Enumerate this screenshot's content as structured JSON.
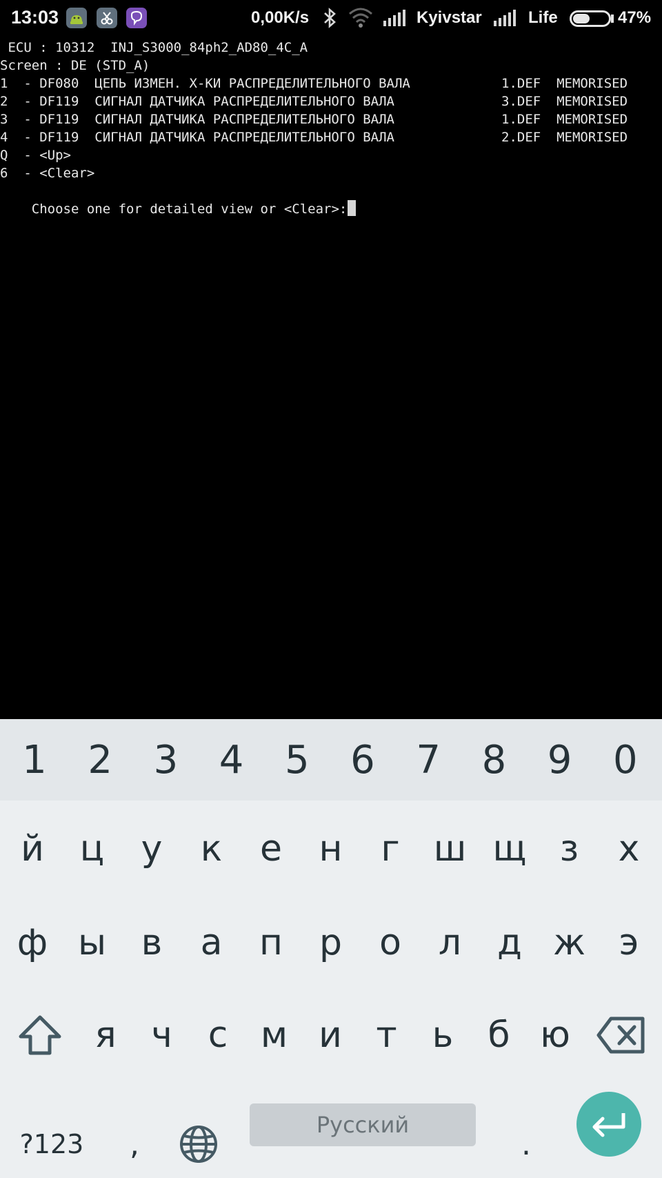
{
  "status_bar": {
    "time": "13:03",
    "net_speed": "0,00K/s",
    "operator_1": "Kyivstar",
    "operator_2": "Life",
    "battery_percent": "47%",
    "battery_level": 0.47,
    "app_icons": [
      "android-app-icon",
      "scissors-app-icon",
      "viber-icon"
    ]
  },
  "terminal": {
    "ecu_line": " ECU : 10312  INJ_S3000_84ph2_AD80_4C_A",
    "screen_line": "Screen : DE (STD_A)",
    "faults": [
      {
        "text": "1  - DF080  ЦЕПЬ ИЗМЕН. Х-КИ РАСПРЕДЕЛИТЕЛЬНОГО ВАЛА",
        "status": "1.DEF  MEMORISED"
      },
      {
        "text": "2  - DF119  СИГНАЛ ДАТЧИКА РАСПРЕДЕЛИТЕЛЬНОГО ВАЛА",
        "status": "3.DEF  MEMORISED"
      },
      {
        "text": "3  - DF119  СИГНАЛ ДАТЧИКА РАСПРЕДЕЛИТЕЛЬНОГО ВАЛА",
        "status": "1.DEF  MEMORISED"
      },
      {
        "text": "4  - DF119  СИГНАЛ ДАТЧИКА РАСПРЕДЕЛИТЕЛЬНОГО ВАЛА",
        "status": "2.DEF  MEMORISED"
      }
    ],
    "options": [
      "Q  - <Up>",
      "6  - <Clear>"
    ],
    "prompt": "Choose one for detailed view or <Clear>:"
  },
  "keyboard": {
    "number_row": [
      "1",
      "2",
      "3",
      "4",
      "5",
      "6",
      "7",
      "8",
      "9",
      "0"
    ],
    "row1": [
      "й",
      "ц",
      "у",
      "к",
      "е",
      "н",
      "г",
      "ш",
      "щ",
      "з",
      "х"
    ],
    "row2": [
      "ф",
      "ы",
      "в",
      "а",
      "п",
      "р",
      "о",
      "л",
      "д",
      "ж",
      "э"
    ],
    "row3": [
      "я",
      "ч",
      "с",
      "м",
      "и",
      "т",
      "ь",
      "б",
      "ю"
    ],
    "symbols_label": "?123",
    "comma": ",",
    "period": ".",
    "space_label": "Русский",
    "accent_color": "#4db6ac"
  }
}
